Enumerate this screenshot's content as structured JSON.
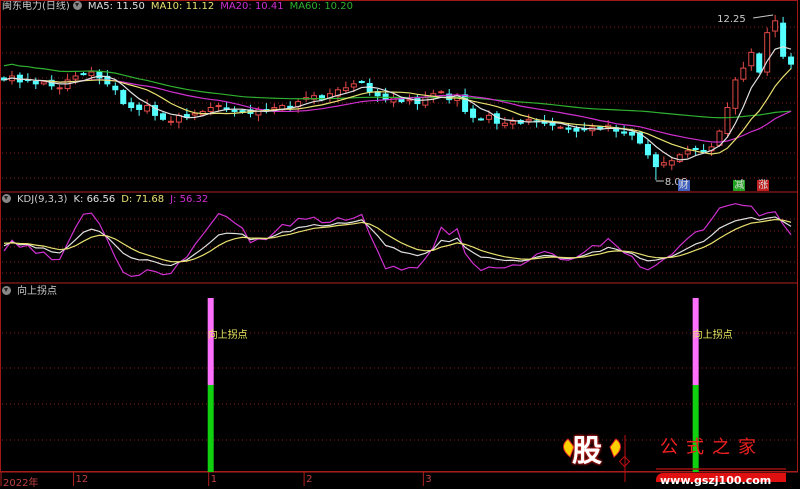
{
  "header": {
    "stock": "闽东电力(日线)",
    "ma5": "MA5: 11.50",
    "ma10": "MA10: 11.12",
    "ma20": "MA20: 10.41",
    "ma60": "MA60: 10.20"
  },
  "kdj_header": {
    "name": "KDJ(9,3,3)",
    "k": "K: 66.56",
    "d": "D: 71.68",
    "j": "J: 56.32"
  },
  "signal_header": {
    "name": "向上拐点"
  },
  "colors": {
    "up": "#e04848",
    "down": "#54ffff",
    "ma5": "#e0e0e0",
    "ma10": "#e8e070",
    "ma20": "#d030d0",
    "ma60": "#30b030",
    "grid": "#8a1a1a",
    "signal_top": "#ff70ff",
    "signal_bottom": "#10d010"
  },
  "chart_data": [
    {
      "type": "candlestick",
      "title": "闽东电力(日线)",
      "annotations": {
        "high": "12.25",
        "low": "8.06"
      },
      "markers": [
        {
          "label": "财",
          "index": 85,
          "color": "#4060c0"
        },
        {
          "label": "减",
          "index": 92,
          "color": "#20a020"
        },
        {
          "label": "涨",
          "index": 95,
          "color": "#c02020"
        }
      ],
      "x_ticks": [
        {
          "label": "2022年",
          "index": 0
        },
        {
          "label": "12",
          "index": 9
        },
        {
          "label": "1",
          "index": 26
        },
        {
          "label": "2",
          "index": 38
        },
        {
          "label": "3",
          "index": 53
        }
      ],
      "close": [
        10.6,
        10.7,
        10.55,
        10.6,
        10.5,
        10.55,
        10.45,
        10.4,
        10.6,
        10.7,
        10.75,
        10.8,
        10.65,
        10.5,
        10.35,
        10.0,
        9.9,
        9.85,
        9.95,
        9.7,
        9.6,
        9.55,
        9.7,
        9.65,
        9.75,
        9.8,
        9.9,
        9.95,
        9.85,
        9.8,
        9.78,
        9.75,
        9.85,
        9.82,
        9.9,
        9.95,
        9.9,
        10.05,
        10.15,
        10.2,
        10.1,
        10.25,
        10.35,
        10.4,
        10.5,
        10.55,
        10.3,
        10.2,
        10.1,
        10.15,
        10.05,
        10.1,
        10.0,
        10.15,
        10.25,
        10.3,
        10.1,
        10.2,
        9.8,
        9.65,
        9.6,
        9.7,
        9.5,
        9.5,
        9.55,
        9.5,
        9.6,
        9.55,
        9.5,
        9.45,
        9.4,
        9.35,
        9.3,
        9.35,
        9.4,
        9.35,
        9.45,
        9.3,
        9.25,
        9.2,
        9.0,
        8.7,
        8.4,
        8.5,
        8.55,
        8.7,
        8.8,
        8.85,
        8.8,
        8.9,
        9.3,
        9.9,
        10.6,
        10.9,
        11.3,
        10.8,
        11.8,
        12.1,
        11.2,
        11.0
      ],
      "high_index": 97,
      "high_value": 12.25,
      "low_index": 82,
      "low_value": 8.06
    },
    {
      "type": "line",
      "title": "KDJ(9,3,3)",
      "series": [
        {
          "name": "K",
          "last": 66.56
        },
        {
          "name": "D",
          "last": 71.68
        },
        {
          "name": "J",
          "last": 56.32
        }
      ]
    },
    {
      "type": "bar",
      "title": "向上拐点",
      "signals": [
        {
          "index": 26,
          "label": "向上拐点"
        },
        {
          "index": 87,
          "label": "向上拐点"
        }
      ]
    }
  ],
  "logo": {
    "badge": "股",
    "name": "公式之家",
    "url": "www.gszj100.com"
  }
}
